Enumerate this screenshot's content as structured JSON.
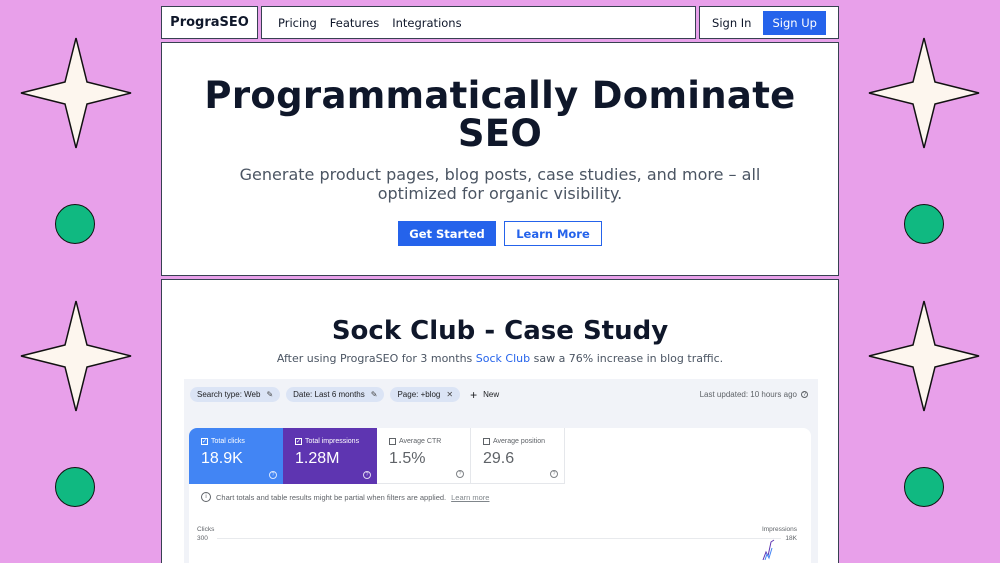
{
  "nav": {
    "brand": "PrograSEO",
    "links": [
      "Pricing",
      "Features",
      "Integrations"
    ],
    "sign_in": "Sign In",
    "sign_up": "Sign Up"
  },
  "hero": {
    "title": "Programmatically Dominate SEO",
    "subtitle": "Generate product pages, blog posts, case studies, and more – all optimized for organic visibility.",
    "primary_cta": "Get Started",
    "secondary_cta": "Learn More"
  },
  "case_study": {
    "title": "Sock Club - Case Study",
    "sub_before": "After using PrograSEO for 3 months ",
    "sub_link": "Sock Club",
    "sub_after": " saw a 76% increase in blog traffic."
  },
  "gsc": {
    "filters": [
      "Search type: Web",
      "Date: Last 6 months",
      "Page: +blog"
    ],
    "new_label": "New",
    "last_updated": "Last updated: 10 hours ago",
    "metrics": {
      "clicks": {
        "label": "Total clicks",
        "value": "18.9K",
        "selected": true
      },
      "impressions": {
        "label": "Total impressions",
        "value": "1.28M",
        "selected": true
      },
      "ctr": {
        "label": "Average CTR",
        "value": "1.5%",
        "selected": false
      },
      "position": {
        "label": "Average position",
        "value": "29.6",
        "selected": false
      }
    },
    "note": "Chart totals and table results might be partial when filters are applied.",
    "note_link": "Learn more",
    "left_axis": {
      "label": "Clicks",
      "top": "300"
    },
    "right_axis": {
      "label": "Impressions",
      "top": "18K"
    }
  },
  "colors": {
    "background": "#e8a0ea",
    "accent": "#2563eb",
    "dot": "#10b981",
    "clicks": "#4285f4",
    "impressions": "#5e35b1"
  },
  "icons": [
    "four-point-star-icon",
    "green-dot-icon",
    "pencil-icon",
    "close-icon",
    "plus-icon",
    "help-icon",
    "info-icon",
    "checkbox-icon"
  ]
}
